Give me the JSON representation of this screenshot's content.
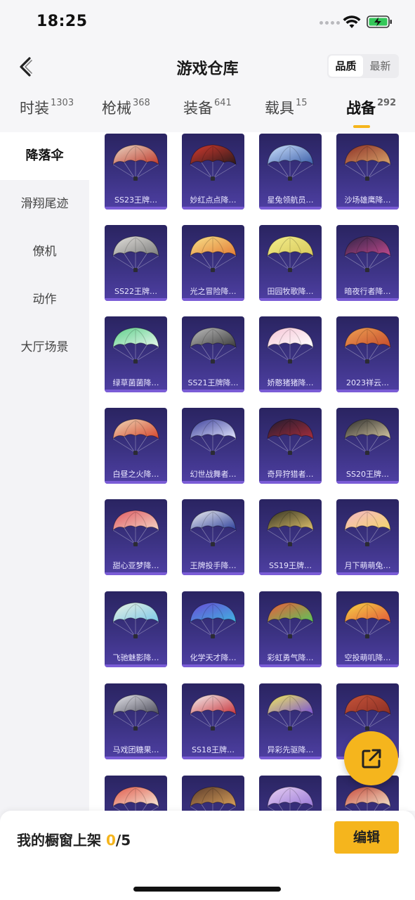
{
  "status_bar": {
    "time": "18:25"
  },
  "nav": {
    "title": "游戏仓库",
    "sort_options": [
      "品质",
      "最新"
    ],
    "active_sort": 0
  },
  "tabs": [
    {
      "label": "时装",
      "count": "1303",
      "active": false
    },
    {
      "label": "枪械",
      "count": "368",
      "active": false
    },
    {
      "label": "装备",
      "count": "641",
      "active": false
    },
    {
      "label": "载具",
      "count": "15",
      "active": false
    },
    {
      "label": "战备",
      "count": "292",
      "active": true
    }
  ],
  "sidebar": {
    "items": [
      {
        "label": "降落伞",
        "active": true
      },
      {
        "label": "滑翔尾迹",
        "active": false
      },
      {
        "label": "僚机",
        "active": false
      },
      {
        "label": "动作",
        "active": false
      },
      {
        "label": "大厅场景",
        "active": false
      }
    ]
  },
  "items": [
    {
      "label": "SS23王牌…",
      "colors": [
        "#e8d7c4",
        "#c0392b"
      ]
    },
    {
      "label": "妙红点点降…",
      "colors": [
        "#d63a2f",
        "#2b1a1a"
      ]
    },
    {
      "label": "星兔领航员…",
      "colors": [
        "#cfe4ff",
        "#3a5da8"
      ]
    },
    {
      "label": "沙场雄鹰降…",
      "colors": [
        "#8b2e24",
        "#d9a56b"
      ]
    },
    {
      "label": "SS22王牌…",
      "colors": [
        "#e4e2dd",
        "#7a7a7a"
      ]
    },
    {
      "label": "光之冒险降…",
      "colors": [
        "#f7e28a",
        "#e47b34"
      ]
    },
    {
      "label": "田园牧歌降…",
      "colors": [
        "#f3ee8c",
        "#d8c85a"
      ]
    },
    {
      "label": "暗夜行者降…",
      "colors": [
        "#2d2243",
        "#c24a8f"
      ]
    },
    {
      "label": "绿草菌菌降…",
      "colors": [
        "#5fcf8a",
        "#e8f8ef"
      ]
    },
    {
      "label": "SS21王牌降…",
      "colors": [
        "#bfbfbf",
        "#3a3a3a"
      ]
    },
    {
      "label": "娇憨猪猪降…",
      "colors": [
        "#f6c5d6",
        "#ffffff"
      ]
    },
    {
      "label": "2023祥云…",
      "colors": [
        "#f0a253",
        "#c44a2c"
      ]
    },
    {
      "label": "白昼之火降…",
      "colors": [
        "#f1d9b8",
        "#d4452c"
      ]
    },
    {
      "label": "幻世战舞者…",
      "colors": [
        "#3b3f9a",
        "#e3e6ff"
      ]
    },
    {
      "label": "奇异狩猎者…",
      "colors": [
        "#1d1a2e",
        "#a82e3c"
      ]
    },
    {
      "label": "SS20王牌…",
      "colors": [
        "#2a2a2a",
        "#d5c7a3"
      ]
    },
    {
      "label": "甜心亚梦降…",
      "colors": [
        "#e05a62",
        "#f3d3c4"
      ]
    },
    {
      "label": "王牌投手降…",
      "colors": [
        "#f2f2f2",
        "#2c3f9a"
      ]
    },
    {
      "label": "SS19王牌…",
      "colors": [
        "#2f2f22",
        "#e1c36b"
      ]
    },
    {
      "label": "月下萌萌兔…",
      "colors": [
        "#f5b7c9",
        "#f3d66a"
      ]
    },
    {
      "label": "飞驰魅影降…",
      "colors": [
        "#e9f2e3",
        "#7ac7e8"
      ]
    },
    {
      "label": "化学天才降…",
      "colors": [
        "#6a4ad6",
        "#3fb4e0"
      ]
    },
    {
      "label": "彩虹勇气降…",
      "colors": [
        "#f05a3c",
        "#5ac65a"
      ]
    },
    {
      "label": "空投萌叽降…",
      "colors": [
        "#f7d245",
        "#e25a3a"
      ]
    },
    {
      "label": "马戏团糖果…",
      "colors": [
        "#e8e8ee",
        "#4a4a58"
      ]
    },
    {
      "label": "SS18王牌…",
      "colors": [
        "#f3f3f3",
        "#c8333a"
      ]
    },
    {
      "label": "异彩先驱降…",
      "colors": [
        "#f3ee5a",
        "#7a52d8"
      ]
    },
    {
      "label": "",
      "colors": [
        "#c8553a",
        "#8a2e24"
      ]
    },
    {
      "label": "",
      "colors": [
        "#e15a4a",
        "#f5e8d8"
      ]
    },
    {
      "label": "",
      "colors": [
        "#5a3a2a",
        "#d8a05a"
      ]
    },
    {
      "label": "",
      "colors": [
        "#e8d0f3",
        "#9a7ad8"
      ]
    },
    {
      "label": "",
      "colors": [
        "#c84a3a",
        "#f0e0c8"
      ]
    }
  ],
  "bottom_bar": {
    "shelf_text": "我的橱窗上架 ",
    "shelf_current": "0",
    "shelf_max": "/5",
    "edit_label": "编辑"
  },
  "colors": {
    "accent": "#f5b51d",
    "card_top": "#2a2461",
    "card_bottom": "#4e3fa3"
  },
  "icons": {
    "back": "chevron-left-icon",
    "share": "share-external-icon",
    "wifi": "wifi-icon",
    "battery": "battery-charging-icon"
  }
}
